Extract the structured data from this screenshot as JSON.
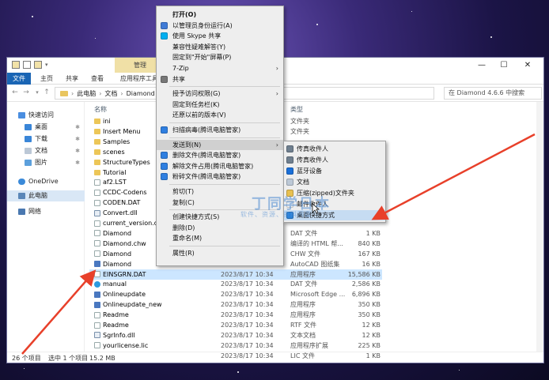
{
  "window": {
    "manage_tab": "管理",
    "ribbon_tabs": [
      "文件",
      "主页",
      "共享",
      "查看",
      "应用程序工具"
    ],
    "controls": [
      "—",
      "☐",
      "✕"
    ]
  },
  "address": {
    "crumbs": [
      "此电脑",
      "文档",
      "Diamond"
    ],
    "search_placeholder": "在 Diamond 4.6.6 中搜索"
  },
  "nav": {
    "items": [
      {
        "label": "快速访问",
        "pinned": false
      },
      {
        "label": "桌面",
        "pinned": true
      },
      {
        "label": "下载",
        "pinned": true
      },
      {
        "label": "文档",
        "pinned": true
      },
      {
        "label": "图片",
        "pinned": true
      },
      {
        "label": "OneDrive",
        "pinned": false
      },
      {
        "label": "此电脑",
        "pinned": false
      },
      {
        "label": "网络",
        "pinned": false
      }
    ]
  },
  "files": {
    "headers": {
      "name": "名称",
      "type": "类型"
    },
    "rows": [
      {
        "name": "ini",
        "icon": "folder",
        "date": "",
        "type": "文件夹",
        "size": ""
      },
      {
        "name": "Insert Menu",
        "icon": "folder",
        "date": "",
        "type": "文件夹",
        "size": ""
      },
      {
        "name": "Samples",
        "icon": "folder",
        "date": "",
        "type": "",
        "size": ""
      },
      {
        "name": "scenes",
        "icon": "folder",
        "date": "",
        "type": "",
        "size": ""
      },
      {
        "name": "StructureTypes",
        "icon": "folder",
        "date": "",
        "type": "",
        "size": ""
      },
      {
        "name": "Tutorial",
        "icon": "folder",
        "date": "",
        "type": "",
        "size": ""
      },
      {
        "name": "af2.LST",
        "icon": "file",
        "date": "",
        "type": "",
        "size": ""
      },
      {
        "name": "CCDC-Codens",
        "icon": "file",
        "date": "",
        "type": "",
        "size": ""
      },
      {
        "name": "CODEN.DAT",
        "icon": "file",
        "date": "",
        "type": "",
        "size": ""
      },
      {
        "name": "Convert.dll",
        "icon": "dll",
        "date": "",
        "type": "",
        "size": ""
      },
      {
        "name": "current_version.dat",
        "icon": "file",
        "date": "",
        "type": "",
        "size": ""
      },
      {
        "name": "Diamond",
        "icon": "file",
        "date": "",
        "type": "DAT 文件",
        "size": "1 KB"
      },
      {
        "name": "Diamond.chw",
        "icon": "file",
        "date": "",
        "type": "编译的 HTML 帮...",
        "size": "840 KB"
      },
      {
        "name": "Diamond",
        "icon": "file",
        "date": "",
        "type": "CHW 文件",
        "size": "167 KB"
      },
      {
        "name": "Diamond",
        "icon": "app",
        "date": "",
        "type": "AutoCAD 图纸集",
        "size": "16 KB"
      },
      {
        "name": "EINSGRN.DAT",
        "icon": "file",
        "date": "2023/8/17 10:34",
        "type": "应用程序",
        "size": "15,586 KB"
      },
      {
        "name": "manual",
        "icon": "edge",
        "date": "2023/8/17 10:34",
        "type": "DAT 文件",
        "size": "2,586 KB"
      },
      {
        "name": "Onlineupdate",
        "icon": "app",
        "date": "2023/8/17 10:34",
        "type": "Microsoft Edge ...",
        "size": "6,896 KB"
      },
      {
        "name": "Onlineupdate_new",
        "icon": "app",
        "date": "2023/8/17 10:34",
        "type": "应用程序",
        "size": "350 KB"
      },
      {
        "name": "Readme",
        "icon": "file",
        "date": "2023/8/17 10:34",
        "type": "应用程序",
        "size": "350 KB"
      },
      {
        "name": "Readme",
        "icon": "file",
        "date": "2023/8/17 10:34",
        "type": "RTF 文件",
        "size": "12 KB"
      },
      {
        "name": "SgrInfo.dll",
        "icon": "dll",
        "date": "2023/8/17 10:34",
        "type": "文本文档",
        "size": "12 KB"
      },
      {
        "name": "yourlicense.lic",
        "icon": "file",
        "date": "2023/8/17 10:34",
        "type": "应用程序扩展",
        "size": "225 KB"
      },
      {
        "name": "",
        "icon": "none",
        "date": "2023/8/17 10:34",
        "type": "LIC 文件",
        "size": "1 KB"
      }
    ],
    "selected_index": 15
  },
  "status": {
    "count": "26 个项目",
    "selected": "选中 1 个项目",
    "size": "15.2 MB"
  },
  "context_menu": {
    "items": [
      {
        "label": "打开(O)",
        "bold": true,
        "icon": ""
      },
      {
        "label": "以管理员身份运行(A)",
        "icon": "shield"
      },
      {
        "label": "使用 Skype 共享",
        "icon": "skype"
      },
      {
        "label": "兼容性疑难解答(Y)",
        "icon": ""
      },
      {
        "label": "固定到\"开始\"屏幕(P)",
        "icon": ""
      },
      {
        "label": "7-Zip",
        "icon": "",
        "sub": true
      },
      {
        "label": "共享",
        "icon": "share"
      },
      {
        "sep": true
      },
      {
        "label": "授予访问权限(G)",
        "icon": "",
        "sub": true
      },
      {
        "label": "固定到任务栏(K)",
        "icon": ""
      },
      {
        "label": "还原以前的版本(V)",
        "icon": ""
      },
      {
        "sep": true
      },
      {
        "label": "扫描病毒(腾讯电脑管家)",
        "icon": "tencent"
      },
      {
        "sep": true
      },
      {
        "label": "发送到(N)",
        "icon": "",
        "sub": true,
        "highlight": true
      },
      {
        "label": "删除文件(腾讯电脑管家)",
        "icon": "tencent"
      },
      {
        "label": "解除文件占用(腾讯电脑管家)",
        "icon": "tencent"
      },
      {
        "label": "粉碎文件(腾讯电脑管家)",
        "icon": "tencent"
      },
      {
        "sep": true
      },
      {
        "label": "剪切(T)",
        "icon": ""
      },
      {
        "label": "复制(C)",
        "icon": ""
      },
      {
        "sep": true
      },
      {
        "label": "创建快捷方式(S)",
        "icon": ""
      },
      {
        "label": "删除(D)",
        "icon": ""
      },
      {
        "label": "重命名(M)",
        "icon": ""
      },
      {
        "sep": true
      },
      {
        "label": "属性(R)",
        "icon": ""
      }
    ]
  },
  "sendto_menu": {
    "items": [
      {
        "label": "传真收件人",
        "icon": "fax"
      },
      {
        "label": "传真收件人",
        "icon": "fax"
      },
      {
        "label": "蓝牙设备",
        "icon": "bluetooth"
      },
      {
        "label": "文档",
        "icon": "doc"
      },
      {
        "label": "压缩(zipped)文件夹",
        "icon": "zip"
      },
      {
        "label": "邮件收件人",
        "icon": "mail"
      },
      {
        "label": "桌面快捷方式",
        "icon": "desktop",
        "highlight": true
      }
    ]
  },
  "watermark": {
    "title": "丁同学日本",
    "subtitle": "软件、资源、资料网盘"
  },
  "colors": {
    "accent": "#1a65b4",
    "arrow": "#e8402a",
    "selection": "#cce6ff",
    "folder": "#ecc658"
  }
}
